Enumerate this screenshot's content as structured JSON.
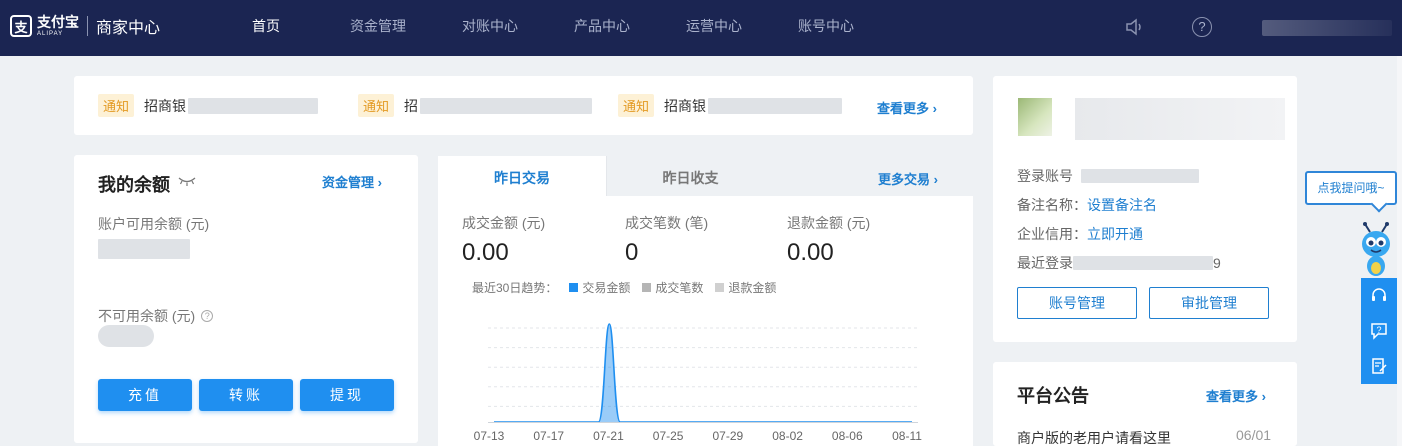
{
  "header": {
    "logo_mark": "支",
    "logo_cn": "支付宝",
    "logo_en": "ALIPAY",
    "portal_title": "商家中心",
    "nav": [
      "首页",
      "资金管理",
      "对账中心",
      "产品中心",
      "运营中心",
      "账号中心"
    ],
    "active_nav": "首页",
    "help_glyph": "?"
  },
  "notices": {
    "items": [
      {
        "tag": "通知",
        "text": "招商银"
      },
      {
        "tag": "通知",
        "text": "招"
      },
      {
        "tag": "通知",
        "text": "招商银"
      }
    ],
    "more": "查看更多 ›"
  },
  "balance": {
    "title": "我的余额",
    "manage_link": "资金管理 ›",
    "available_label": "账户可用余额 (元)",
    "unavailable_label": "不可用余额 (元)",
    "help_glyph": "?",
    "buttons": [
      "充值",
      "转账",
      "提现"
    ]
  },
  "trade": {
    "tabs": [
      "昨日交易",
      "昨日收支"
    ],
    "active_tab": "昨日交易",
    "more": "更多交易 ›",
    "metrics": [
      {
        "label": "成交金额 (元)",
        "value": "0.00"
      },
      {
        "label": "成交笔数 (笔)",
        "value": "0"
      },
      {
        "label": "退款金额 (元)",
        "value": "0.00"
      }
    ],
    "legend_title": "最近30日趋势：",
    "legend": [
      {
        "name": "交易金额",
        "color": "#1f8ff0"
      },
      {
        "name": "成交笔数",
        "color": "#b5b5b5"
      },
      {
        "name": "退款金额",
        "color": "#d0d0d0"
      }
    ]
  },
  "chart_data": {
    "type": "area",
    "x_ticks": [
      "07-13",
      "07-17",
      "07-21",
      "07-25",
      "07-29",
      "08-02",
      "08-06",
      "08-11"
    ],
    "series": [
      {
        "name": "交易金额",
        "color": "#1f8ff0",
        "x": [
          "07-13",
          "07-14",
          "07-15",
          "07-16",
          "07-17",
          "07-18",
          "07-19",
          "07-20",
          "07-21",
          "07-22",
          "07-23",
          "07-24",
          "07-25",
          "07-26",
          "07-27",
          "07-28",
          "07-29",
          "07-30",
          "07-31",
          "08-01",
          "08-02",
          "08-03",
          "08-04",
          "08-05",
          "08-06",
          "08-07",
          "08-08",
          "08-09",
          "08-10",
          "08-11"
        ],
        "values": [
          0,
          0,
          0,
          0,
          0,
          0,
          0,
          0,
          1,
          0,
          0,
          0,
          0,
          0,
          0,
          0,
          0,
          0,
          0,
          0,
          0,
          0,
          0,
          0,
          0,
          0,
          0,
          0,
          0,
          0
        ]
      }
    ],
    "grid": true,
    "ylim": [
      0,
      1
    ]
  },
  "account": {
    "login_label": "登录账号",
    "remark_label": "备注名称：",
    "remark_link": "设置备注名",
    "credit_label": "企业信用：",
    "credit_link": "立即开通",
    "last_login_label": "最近登录",
    "last_login_tail": "9",
    "buttons": [
      "账号管理",
      "审批管理"
    ]
  },
  "announcement": {
    "title": "平台公告",
    "more": "查看更多 ›",
    "item": "商户版的老用户请看这里",
    "date": "06/01"
  },
  "helper": {
    "bubble": "点我提问哦~"
  },
  "colors": {
    "header_bg": "#1b2552",
    "accent": "#1f8ff0",
    "link": "#1f7fd0",
    "notice_tag_bg": "#fdf1d6",
    "notice_tag_text": "#e39a22"
  }
}
